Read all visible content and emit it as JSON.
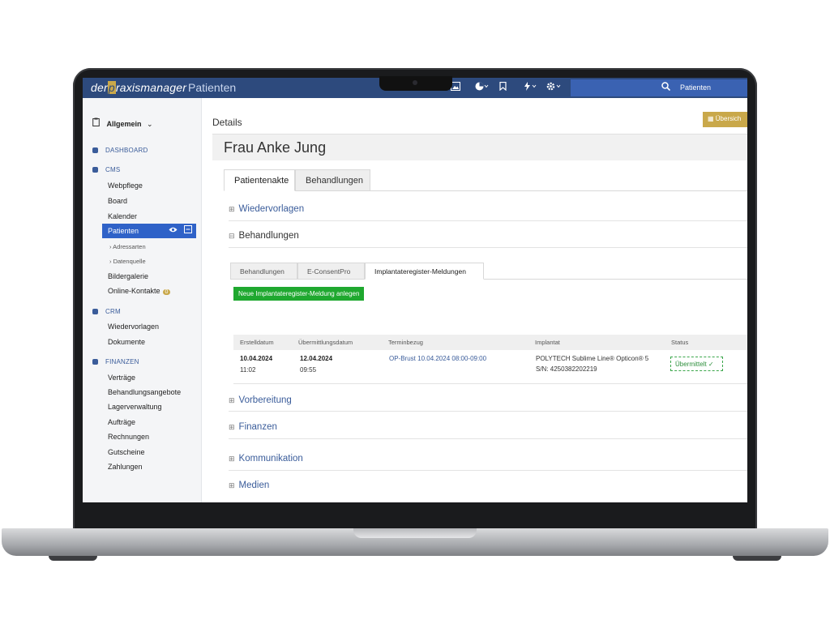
{
  "app": {
    "logo_prefix": "der",
    "logo_p": "p",
    "logo_rest": "raxismanager",
    "title": "Patienten"
  },
  "topbar": {
    "icons": [
      "image-icon",
      "pie-chart-icon",
      "bookmark-icon",
      "bolt-icon",
      "gear-icon"
    ],
    "search_placeholder": "Patienten"
  },
  "sidebar": {
    "context": "Allgemein",
    "sections": [
      {
        "label": "DASHBOARD"
      },
      {
        "label": "CMS"
      },
      {
        "label": "CRM"
      },
      {
        "label": "FINANZEN"
      }
    ],
    "cms_items": [
      "Webpflege",
      "Board",
      "Kalender"
    ],
    "active_item": "Patienten",
    "sub_items": [
      "Adressarten",
      "Datenquelle"
    ],
    "cms_items_after": [
      "Bildergalerie",
      "Online-Kontakte"
    ],
    "online_kontakte_badge": "0",
    "crm_items": [
      "Wiedervorlagen",
      "Dokumente"
    ],
    "finanzen_items": [
      "Verträge",
      "Behandlungsangebote",
      "Lagerverwaltung",
      "Aufträge",
      "Rechnungen",
      "Gutscheine",
      "Zahlungen"
    ]
  },
  "main": {
    "details_label": "Details",
    "uebersicht_label": "Übersich",
    "patient_name": "Frau Anke Jung",
    "tabs": [
      "Patientenakte",
      "Behandlungen"
    ],
    "sections": {
      "wiedervorlagen": "Wiedervorlagen",
      "behandlungen": "Behandlungen",
      "vorbereitung": "Vorbereitung",
      "finanzen": "Finanzen",
      "kommunikation": "Kommunikation",
      "medien": "Medien"
    },
    "subtabs": [
      "Behandlungen",
      "E-ConsentPro",
      "Implantateregister-Meldungen"
    ],
    "new_button": "Neue Implantateregister-Meldung anlegen",
    "table": {
      "headers": [
        "Erstelldatum",
        "Übermittlungsdatum",
        "Terminbezug",
        "Implantat",
        "Status"
      ],
      "row": {
        "erstell_date": "10.04.2024",
        "erstell_time": "11:02",
        "uebermittlung_date": "12.04.2024",
        "uebermittlung_time": "09:55",
        "terminbezug": "OP-Brust 10.04.2024 08:00-09:00",
        "implantat_line1": "POLYTECH Sublime Line® Opticon® 5",
        "implantat_line2": "S/N: 4250382202219",
        "status": "Übermittelt ✓"
      }
    }
  },
  "colors": {
    "topbar": "#2d4a7d",
    "search": "#3a62b2",
    "accent_gold": "#c9a84a",
    "active_blue": "#2f62c8",
    "button_green": "#1fa82f",
    "link_blue": "#3a5c9a"
  }
}
